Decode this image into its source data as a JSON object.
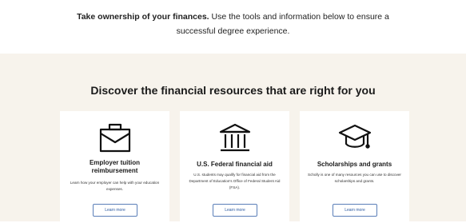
{
  "intro": {
    "bold": "Take ownership of your finances.",
    "rest_line1": " Use the tools and information below to ensure a",
    "line2": "successful degree experience."
  },
  "section": {
    "title": "Discover the financial resources that are right for you"
  },
  "cards": [
    {
      "icon": "briefcase-icon",
      "title_line1": "Employer tuition",
      "title_line2": "reimbursement",
      "desc": "Learn how your employer can help with your education expenses.",
      "button": "Learn more"
    },
    {
      "icon": "bank-building-icon",
      "title_line1": "U.S. Federal financial aid",
      "title_line2": "",
      "desc": "U.S. students may qualify for financial aid from the Department of Education's Office of Federal Student Aid (FSA).",
      "button": "Learn more"
    },
    {
      "icon": "graduation-cap-icon",
      "title_line1": "Scholarships and grants",
      "title_line2": "",
      "desc": "Scholly is one of many resources you can use to discover scholarships and grants.",
      "button": "Learn more"
    }
  ],
  "colors": {
    "section_bg": "#f7f3ec",
    "button_border": "#5b7fb8",
    "button_text": "#2d5aa0"
  }
}
